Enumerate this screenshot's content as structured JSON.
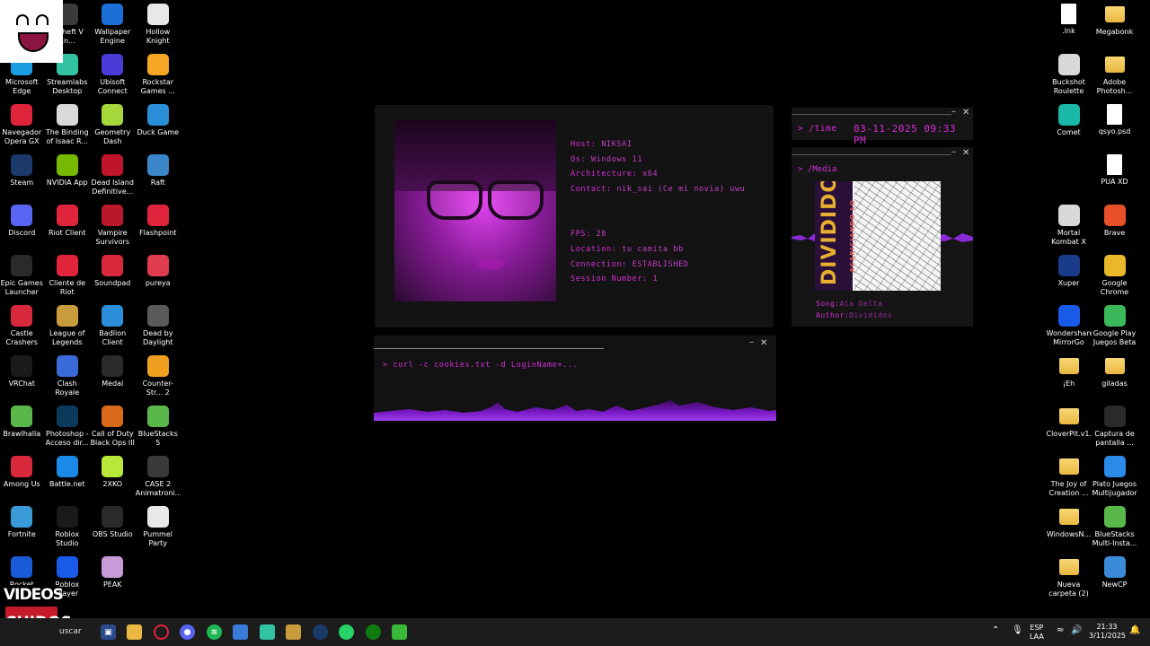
{
  "desktop": {
    "left_icons": [
      {
        "label": "",
        "icon": "awesome-face-icon",
        "color": "#ffffff"
      },
      {
        "label": "d Theft V En...",
        "icon": "gta-icon",
        "color": "#3a3a3a"
      },
      {
        "label": "Wallpaper Engine",
        "icon": "wallpaper-engine-icon",
        "color": "#1d6fd8"
      },
      {
        "label": "Hollow Knight",
        "icon": "hollow-knight-icon",
        "color": "#e8e8e8"
      },
      {
        "label": "Microsoft Edge",
        "icon": "edge-icon",
        "color": "#1b9de2"
      },
      {
        "label": "Streamlabs Desktop",
        "icon": "streamlabs-icon",
        "color": "#31c3a2"
      },
      {
        "label": "Ubisoft Connect",
        "icon": "ubisoft-icon",
        "color": "#4b3bd6"
      },
      {
        "label": "Rockstar Games ...",
        "icon": "rockstar-icon",
        "color": "#f5a623"
      },
      {
        "label": "Navegador Opera GX",
        "icon": "opera-gx-icon",
        "color": "#e0243c"
      },
      {
        "label": "The Binding of Isaac R...",
        "icon": "isaac-icon",
        "color": "#d9d9d9"
      },
      {
        "label": "Geometry Dash",
        "icon": "geometry-dash-icon",
        "color": "#a5d63a"
      },
      {
        "label": "Duck Game",
        "icon": "duck-game-icon",
        "color": "#2a8fd8"
      },
      {
        "label": "Steam",
        "icon": "steam-icon",
        "color": "#1b3a6b"
      },
      {
        "label": "NVIDIA App",
        "icon": "nvidia-icon",
        "color": "#76b900"
      },
      {
        "label": "Dead Island Definitive...",
        "icon": "dead-island-icon",
        "color": "#c0142a"
      },
      {
        "label": "Raft",
        "icon": "raft-icon",
        "color": "#3a86c8"
      },
      {
        "label": "Discord",
        "icon": "discord-icon",
        "color": "#5865f2"
      },
      {
        "label": "Riot Client",
        "icon": "riot-icon",
        "color": "#e0243c"
      },
      {
        "label": "Vampire Survivors",
        "icon": "vampire-survivors-icon",
        "color": "#b8182a"
      },
      {
        "label": "Flashpoint",
        "icon": "flashpoint-icon",
        "color": "#e0243c"
      },
      {
        "label": "Epic Games Launcher",
        "icon": "epic-icon",
        "color": "#2a2a2a"
      },
      {
        "label": "Cliente de Riot",
        "icon": "riot-icon",
        "color": "#e0243c"
      },
      {
        "label": "Soundpad",
        "icon": "soundpad-icon",
        "color": "#d8283c"
      },
      {
        "label": "pureya",
        "icon": "pureya-icon",
        "color": "#e03c50"
      },
      {
        "label": "Castle Crashers",
        "icon": "castle-crashers-icon",
        "color": "#d8283c"
      },
      {
        "label": "League of Legends",
        "icon": "league-icon",
        "color": "#c89b3c"
      },
      {
        "label": "Badlion Client",
        "icon": "badlion-icon",
        "color": "#2a8fd8"
      },
      {
        "label": "Dead by Daylight",
        "icon": "dbd-icon",
        "color": "#5a5a5a"
      },
      {
        "label": "VRChat",
        "icon": "vrchat-icon",
        "color": "#1a1a1a"
      },
      {
        "label": "Clash Royale",
        "icon": "clash-royale-icon",
        "color": "#3a6ad8"
      },
      {
        "label": "Medal",
        "icon": "medal-icon",
        "color": "#2a2a2a"
      },
      {
        "label": "Counter-Str... 2",
        "icon": "cs2-icon",
        "color": "#f0a020"
      },
      {
        "label": "Brawlhalla",
        "icon": "brawlhalla-icon",
        "color": "#5ab84a"
      },
      {
        "label": "Photoshop - Acceso dir...",
        "icon": "photoshop-icon",
        "color": "#0b3a5c"
      },
      {
        "label": "Call of Duty Black Ops III",
        "icon": "cod-icon",
        "color": "#d86a1a"
      },
      {
        "label": "BlueStacks 5",
        "icon": "bluestacks-icon",
        "color": "#5ab84a"
      },
      {
        "label": "Among Us",
        "icon": "among-us-icon",
        "color": "#d8283c"
      },
      {
        "label": "Battle.net",
        "icon": "battlenet-icon",
        "color": "#1a8ae8"
      },
      {
        "label": "2XKO",
        "icon": "2xko-icon",
        "color": "#b8e83a"
      },
      {
        "label": "CASE 2 Animatroni...",
        "icon": "case2-icon",
        "color": "#3a3a3a"
      },
      {
        "label": "Fortnite",
        "icon": "fortnite-icon",
        "color": "#3a9ad8"
      },
      {
        "label": "Roblox Studio",
        "icon": "roblox-studio-icon",
        "color": "#1a1a1a"
      },
      {
        "label": "OBS Studio",
        "icon": "obs-icon",
        "color": "#2a2a2a"
      },
      {
        "label": "Pummel Party",
        "icon": "pummel-party-icon",
        "color": "#e8e8e8"
      },
      {
        "label": "Rocket",
        "icon": "rocket-league-icon",
        "color": "#1a5ad8"
      },
      {
        "label": "Roblox Player",
        "icon": "roblox-icon",
        "color": "#1a5ae8"
      },
      {
        "label": "PEAK",
        "icon": "peak-icon",
        "color": "#c89ad8"
      }
    ],
    "right_icons": [
      {
        "label": ".lnk",
        "icon": "shortcut-file-icon",
        "kind": "file"
      },
      {
        "label": "Megabonk",
        "icon": "folder-icon",
        "kind": "folder"
      },
      {
        "label": "Buckshot Roulette",
        "icon": "buckshot-icon",
        "kind": "app",
        "color": "#d8d8d8"
      },
      {
        "label": "Adobe Photosh...",
        "icon": "folder-icon",
        "kind": "folder"
      },
      {
        "label": "Comet",
        "icon": "comet-icon",
        "kind": "app",
        "color": "#1ab8a8"
      },
      {
        "label": "qsyo.psd",
        "icon": "psd-file-icon",
        "kind": "file"
      },
      {
        "label": "",
        "icon": "",
        "kind": "empty"
      },
      {
        "label": "PUA XD",
        "icon": "text-file-icon",
        "kind": "file"
      },
      {
        "label": "Mortal Kombat X",
        "icon": "mkx-icon",
        "kind": "app",
        "color": "#d8d8d8"
      },
      {
        "label": "Brave",
        "icon": "brave-icon",
        "kind": "app",
        "color": "#e8502a"
      },
      {
        "label": "Xuper",
        "icon": "xuper-icon",
        "kind": "app",
        "color": "#1a3a8a"
      },
      {
        "label": "Google Chrome",
        "icon": "chrome-icon",
        "kind": "app",
        "color": "#e8b82a"
      },
      {
        "label": "Wondershare MirrorGo",
        "icon": "mirrorgo-icon",
        "kind": "app",
        "color": "#1a5ae8"
      },
      {
        "label": "Google Play Juegos Beta",
        "icon": "google-play-games-icon",
        "kind": "app",
        "color": "#3ab85a"
      },
      {
        "label": "¡Eh",
        "icon": "folder-icon",
        "kind": "folder"
      },
      {
        "label": "giladas",
        "icon": "folder-icon",
        "kind": "folder"
      },
      {
        "label": "CloverPit.v1.1",
        "icon": "folder-icon",
        "kind": "folder"
      },
      {
        "label": "Captura de pantalla ...",
        "icon": "screenshot-file-icon",
        "kind": "app",
        "color": "#2a2a2a"
      },
      {
        "label": "The Joy of Creation ...",
        "icon": "folder-icon",
        "kind": "folder"
      },
      {
        "label": "Plato Juegos Multijugador",
        "icon": "plato-icon",
        "kind": "app",
        "color": "#2a8ae8"
      },
      {
        "label": "WindowsN...",
        "icon": "folder-icon",
        "kind": "folder"
      },
      {
        "label": "BlueStacks Multi-Insta...",
        "icon": "bluestacks-icon",
        "kind": "app",
        "color": "#5ab84a"
      },
      {
        "label": "Nueva carpeta (2)",
        "icon": "folder-icon",
        "kind": "folder"
      },
      {
        "label": "NewCP",
        "icon": "newcp-icon",
        "kind": "app",
        "color": "#3a8ad8"
      }
    ]
  },
  "watermark": {
    "line1": "VIDEOS",
    "line2": "CHIDOS"
  },
  "profile": {
    "lines_top": [
      {
        "key": "Host:",
        "value": "NIKSAI"
      },
      {
        "key": "Os:",
        "value": "Windows 11"
      },
      {
        "key": "Architecture:",
        "value": "x64"
      },
      {
        "key": "Contact:",
        "value": "nik_sai (Ce mi novia) uwu"
      }
    ],
    "lines_bottom": [
      {
        "key": "FPS:",
        "value": "28"
      },
      {
        "key": "Location:",
        "value": "tu camita bb"
      },
      {
        "key": "Connection:",
        "value": "ESTABLISHED"
      },
      {
        "key": "Session Number:",
        "value": "1"
      }
    ]
  },
  "time_widget": {
    "label": "> /time",
    "value": "03-11-2025 09:33 PM",
    "minimize": "–",
    "close": "✕"
  },
  "media_widget": {
    "label": "> /Media",
    "cover_title": "DIVIDIDOS",
    "cover_subtitle": "ACARICIANDO LO ÁSPERO",
    "song_key": "Song:",
    "song": "Ala Delta",
    "author_key": "Author:",
    "author": "Divididos",
    "minimize": "–",
    "close": "✕"
  },
  "terminal": {
    "command": "> curl -c cookies.txt -d LoginName=...",
    "minimize": "–",
    "close": "✕"
  },
  "taskbar": {
    "search_fragment": "uscar",
    "language": "ESP",
    "layout": "LAA",
    "time": "21:33",
    "date": "3/11/2025"
  },
  "colors": {
    "accent": "#d62dd8",
    "value": "#c63fc8",
    "wave": "#8a2ad8"
  }
}
